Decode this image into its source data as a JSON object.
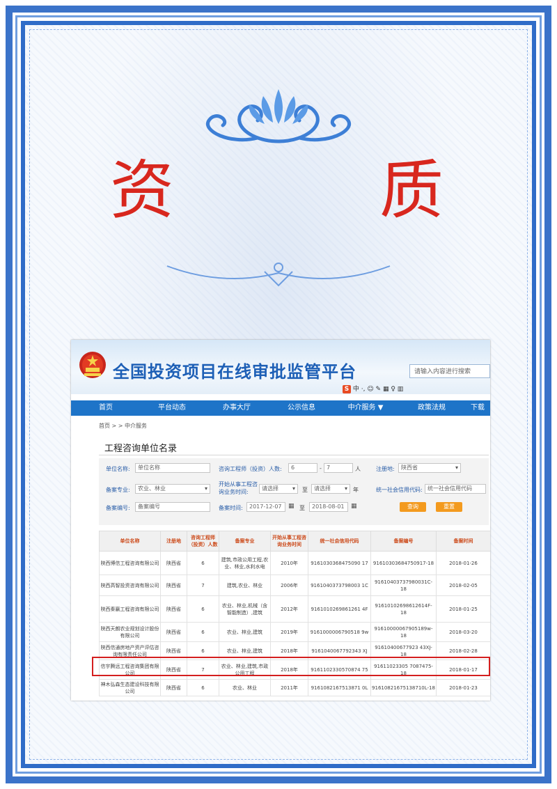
{
  "certificate": {
    "title_chars": [
      "资",
      "质"
    ]
  },
  "site": {
    "title": "全国投资项目在线审批监管平台",
    "search_placeholder": "请输入内容进行搜索",
    "toolbar_text": "中 ·, ☺ ✎ ▦ ♀ ▥"
  },
  "nav": [
    "首页",
    "平台动态",
    "办事大厅",
    "公示信息",
    "中介服务 ▼",
    "政策法规",
    "下载"
  ],
  "breadcrumb": "首页 > > 中介服务",
  "page_title": "工程咨询单位名录",
  "filters": {
    "unit_name_label": "单位名称:",
    "unit_name_placeholder": "单位名称",
    "engineer_count_label": "咨询工程师（投资）人数:",
    "count_min": "6",
    "count_dash": "-",
    "count_max": "7",
    "count_unit": "人",
    "reg_place_label": "注册地:",
    "reg_place_value": "陕西省",
    "specialty_label": "备案专业:",
    "specialty_value": "农业、林业",
    "start_time_label": "开始从事工程咨询业务时间:",
    "start_from": "请选择",
    "start_to_label": "至",
    "start_to": "请选择",
    "year_unit": "年",
    "credit_code_label": "统一社会信用代码:",
    "credit_code_placeholder": "统一社会信用代码",
    "record_no_label": "备案编号:",
    "record_no_placeholder": "备案编号",
    "record_time_label": "备案时间:",
    "record_time_from": "2017-12-07",
    "record_time_to_label": "至",
    "record_time_to": "2018-08-01",
    "search_button": "查询",
    "reset_button": "重置"
  },
  "table": {
    "headers": [
      "单位名称",
      "注册地",
      "咨询工程师（投资）人数",
      "备案专业",
      "开始从事工程咨询业务时间",
      "统一社会信用代码",
      "备案编号",
      "备案时间"
    ],
    "rows": [
      [
        "陕西博信工程咨询有限公司",
        "陕西省",
        "6",
        "建筑,市政公用工程,农业、林业,水利水电",
        "2010年",
        "9161030368475090 17",
        "91610303684750917-18",
        "2018-01-26"
      ],
      [
        "陕西高智投资咨询有限公司",
        "陕西省",
        "7",
        "建筑,农业、林业",
        "2006年",
        "9161040373798003 1C",
        "91610403737980031C-18",
        "2018-02-05"
      ],
      [
        "陕西秦嬴工程咨询有限公司",
        "陕西省",
        "6",
        "农业、林业,机械（含智能制造）,建筑",
        "2012年",
        "9161010269861261 4F",
        "91610102698612614F-18",
        "2018-01-25"
      ],
      [
        "陕西天朗农业规划设计股份有限公司",
        "陕西省",
        "6",
        "农业、林业,建筑",
        "2019年",
        "9161000006790518 9w",
        "91610000067905189w-18",
        "2018-03-20"
      ],
      [
        "陕西信通房地产资产评估咨询有限责任公司",
        "陕西省",
        "6",
        "农业、林业,建筑",
        "2018年",
        "9161040067792343 XJ",
        "91610400677923 43XJ-18",
        "2018-02-28"
      ],
      [
        "信宇腾远工程咨询集团有限公司",
        "陕西省",
        "7",
        "农业、林业,建筑,市政公用工程",
        "2018年",
        "9161102330570874 75",
        "91611023305 7087475-18",
        "2018-01-17"
      ],
      [
        "神木弘森生态建设科技有限公司",
        "陕西省",
        "6",
        "农业、林业",
        "2011年",
        "9161082167513871 0L",
        "91610821675138710L-18",
        "2018-01-23"
      ]
    ]
  }
}
